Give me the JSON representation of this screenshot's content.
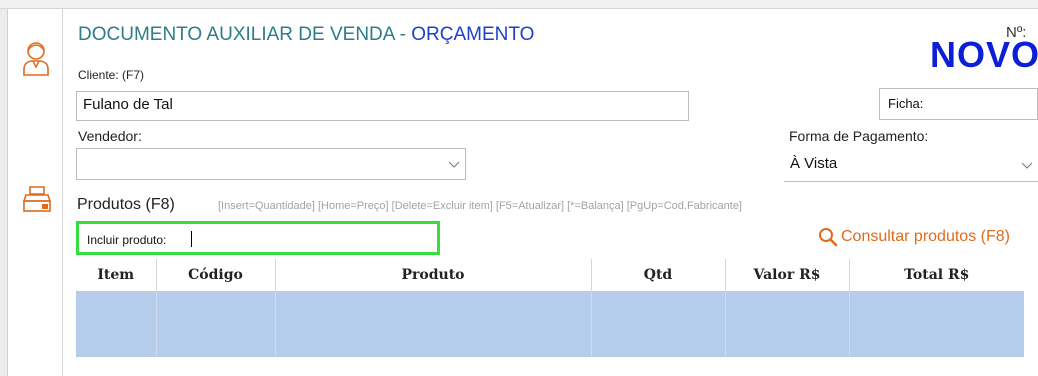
{
  "header": {
    "title_prefix": "DOCUMENTO AUXILIAR DE VENDA - ",
    "title_highlight": "ORÇAMENTO",
    "number_label": "Nº:",
    "number_value": "NOVO"
  },
  "sidebar": {
    "icons": [
      "customer-icon",
      "cash-register-icon"
    ]
  },
  "cliente": {
    "label": "Cliente: (F7)",
    "value": "Fulano de Tal"
  },
  "ficha": {
    "label": "Ficha:",
    "value": ""
  },
  "vendedor": {
    "label": "Vendedor:",
    "value": ""
  },
  "pagamento": {
    "label": "Forma de Pagamento:",
    "value": "À Vista"
  },
  "produtos": {
    "title": "Produtos (F8)",
    "shortcuts": "[Insert=Quantidade] [Home=Preço] [Delete=Excluir item] [F5=Atualizar] [*=Balança] [PgUp=Cod.Fabricante]",
    "include_label": "Incluir produto:",
    "include_value": "",
    "consultar_label": "Consultar produtos (F8)"
  },
  "table": {
    "columns": [
      "Item",
      "Código",
      "Produto",
      "Qtd",
      "Valor R$",
      "Total R$"
    ],
    "rows": [
      [
        "",
        "",
        "",
        "",
        "",
        ""
      ]
    ]
  },
  "colors": {
    "accent_title": "#2d7d8a",
    "accent_blue": "#0a1fd6",
    "consultar_orange": "#e06b1c",
    "focus_green": "#39dd3c",
    "row_selected": "#b6cceb"
  }
}
